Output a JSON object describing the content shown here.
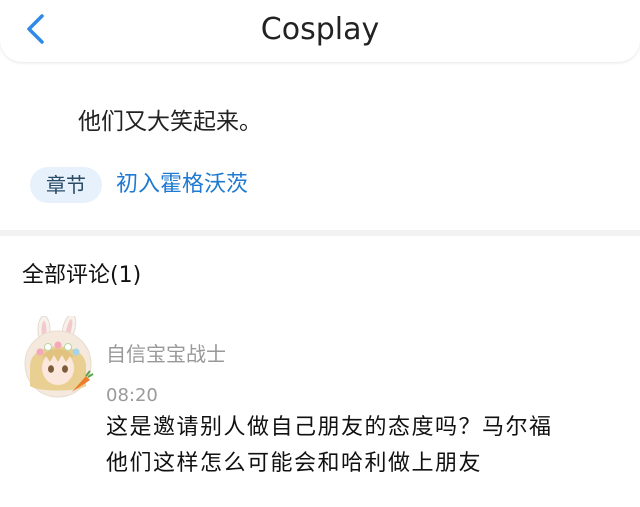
{
  "header": {
    "title": "Cosplay"
  },
  "post": {
    "quote": "他们又大笑起来。",
    "chapter_badge": "章节",
    "chapter_title": "初入霍格沃茨"
  },
  "comments": {
    "heading": "全部评论(1)",
    "items": [
      {
        "username": "自信宝宝战士",
        "time": "08:20",
        "text_lines": [
          "这是邀请别人做自己朋友的态度吗？马尔福",
          "他们这样怎么可能会和哈利做上朋友"
        ]
      }
    ]
  },
  "colors": {
    "accent": "#1f7ad1",
    "badge_bg": "#e7f1fb",
    "back_arrow": "#2e8ae6"
  }
}
